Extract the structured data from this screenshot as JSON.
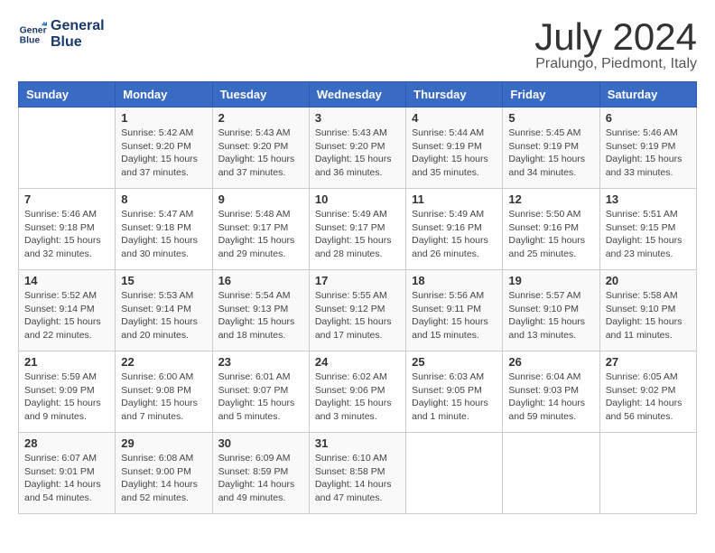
{
  "logo": {
    "line1": "General",
    "line2": "Blue"
  },
  "title": "July 2024",
  "location": "Pralungo, Piedmont, Italy",
  "headers": [
    "Sunday",
    "Monday",
    "Tuesday",
    "Wednesday",
    "Thursday",
    "Friday",
    "Saturday"
  ],
  "weeks": [
    [
      {
        "day": "",
        "info": ""
      },
      {
        "day": "1",
        "info": "Sunrise: 5:42 AM\nSunset: 9:20 PM\nDaylight: 15 hours\nand 37 minutes."
      },
      {
        "day": "2",
        "info": "Sunrise: 5:43 AM\nSunset: 9:20 PM\nDaylight: 15 hours\nand 37 minutes."
      },
      {
        "day": "3",
        "info": "Sunrise: 5:43 AM\nSunset: 9:20 PM\nDaylight: 15 hours\nand 36 minutes."
      },
      {
        "day": "4",
        "info": "Sunrise: 5:44 AM\nSunset: 9:19 PM\nDaylight: 15 hours\nand 35 minutes."
      },
      {
        "day": "5",
        "info": "Sunrise: 5:45 AM\nSunset: 9:19 PM\nDaylight: 15 hours\nand 34 minutes."
      },
      {
        "day": "6",
        "info": "Sunrise: 5:46 AM\nSunset: 9:19 PM\nDaylight: 15 hours\nand 33 minutes."
      }
    ],
    [
      {
        "day": "7",
        "info": "Sunrise: 5:46 AM\nSunset: 9:18 PM\nDaylight: 15 hours\nand 32 minutes."
      },
      {
        "day": "8",
        "info": "Sunrise: 5:47 AM\nSunset: 9:18 PM\nDaylight: 15 hours\nand 30 minutes."
      },
      {
        "day": "9",
        "info": "Sunrise: 5:48 AM\nSunset: 9:17 PM\nDaylight: 15 hours\nand 29 minutes."
      },
      {
        "day": "10",
        "info": "Sunrise: 5:49 AM\nSunset: 9:17 PM\nDaylight: 15 hours\nand 28 minutes."
      },
      {
        "day": "11",
        "info": "Sunrise: 5:49 AM\nSunset: 9:16 PM\nDaylight: 15 hours\nand 26 minutes."
      },
      {
        "day": "12",
        "info": "Sunrise: 5:50 AM\nSunset: 9:16 PM\nDaylight: 15 hours\nand 25 minutes."
      },
      {
        "day": "13",
        "info": "Sunrise: 5:51 AM\nSunset: 9:15 PM\nDaylight: 15 hours\nand 23 minutes."
      }
    ],
    [
      {
        "day": "14",
        "info": "Sunrise: 5:52 AM\nSunset: 9:14 PM\nDaylight: 15 hours\nand 22 minutes."
      },
      {
        "day": "15",
        "info": "Sunrise: 5:53 AM\nSunset: 9:14 PM\nDaylight: 15 hours\nand 20 minutes."
      },
      {
        "day": "16",
        "info": "Sunrise: 5:54 AM\nSunset: 9:13 PM\nDaylight: 15 hours\nand 18 minutes."
      },
      {
        "day": "17",
        "info": "Sunrise: 5:55 AM\nSunset: 9:12 PM\nDaylight: 15 hours\nand 17 minutes."
      },
      {
        "day": "18",
        "info": "Sunrise: 5:56 AM\nSunset: 9:11 PM\nDaylight: 15 hours\nand 15 minutes."
      },
      {
        "day": "19",
        "info": "Sunrise: 5:57 AM\nSunset: 9:10 PM\nDaylight: 15 hours\nand 13 minutes."
      },
      {
        "day": "20",
        "info": "Sunrise: 5:58 AM\nSunset: 9:10 PM\nDaylight: 15 hours\nand 11 minutes."
      }
    ],
    [
      {
        "day": "21",
        "info": "Sunrise: 5:59 AM\nSunset: 9:09 PM\nDaylight: 15 hours\nand 9 minutes."
      },
      {
        "day": "22",
        "info": "Sunrise: 6:00 AM\nSunset: 9:08 PM\nDaylight: 15 hours\nand 7 minutes."
      },
      {
        "day": "23",
        "info": "Sunrise: 6:01 AM\nSunset: 9:07 PM\nDaylight: 15 hours\nand 5 minutes."
      },
      {
        "day": "24",
        "info": "Sunrise: 6:02 AM\nSunset: 9:06 PM\nDaylight: 15 hours\nand 3 minutes."
      },
      {
        "day": "25",
        "info": "Sunrise: 6:03 AM\nSunset: 9:05 PM\nDaylight: 15 hours\nand 1 minute."
      },
      {
        "day": "26",
        "info": "Sunrise: 6:04 AM\nSunset: 9:03 PM\nDaylight: 14 hours\nand 59 minutes."
      },
      {
        "day": "27",
        "info": "Sunrise: 6:05 AM\nSunset: 9:02 PM\nDaylight: 14 hours\nand 56 minutes."
      }
    ],
    [
      {
        "day": "28",
        "info": "Sunrise: 6:07 AM\nSunset: 9:01 PM\nDaylight: 14 hours\nand 54 minutes."
      },
      {
        "day": "29",
        "info": "Sunrise: 6:08 AM\nSunset: 9:00 PM\nDaylight: 14 hours\nand 52 minutes."
      },
      {
        "day": "30",
        "info": "Sunrise: 6:09 AM\nSunset: 8:59 PM\nDaylight: 14 hours\nand 49 minutes."
      },
      {
        "day": "31",
        "info": "Sunrise: 6:10 AM\nSunset: 8:58 PM\nDaylight: 14 hours\nand 47 minutes."
      },
      {
        "day": "",
        "info": ""
      },
      {
        "day": "",
        "info": ""
      },
      {
        "day": "",
        "info": ""
      }
    ]
  ]
}
